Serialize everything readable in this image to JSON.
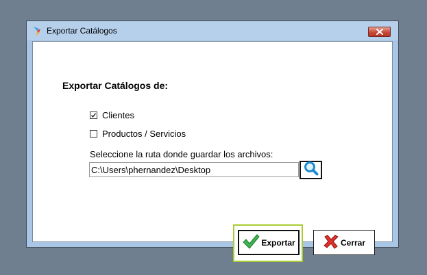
{
  "window": {
    "title": "Exportar Catálogos",
    "close_icon": "close-icon",
    "app_icon": "app-logo-icon"
  },
  "form": {
    "heading": "Exportar Catálogos de:",
    "options": [
      {
        "label": "Clientes",
        "checked": true
      },
      {
        "label": "Productos / Servicios",
        "checked": false
      }
    ],
    "path_label": "Seleccione la ruta donde guardar los archivos:",
    "path_value": "C:\\Users\\phernandez\\Desktop",
    "browse_icon": "magnifier-icon"
  },
  "buttons": {
    "export_label": "Exportar",
    "export_icon": "checkmark-icon",
    "cancel_label": "Cerrar",
    "cancel_icon": "red-x-icon"
  },
  "colors": {
    "desktop": "#6f7f8f",
    "window_frame": "#a9c6e6",
    "focus_ring": "#a9cc32",
    "close_red": "#c8493a"
  }
}
